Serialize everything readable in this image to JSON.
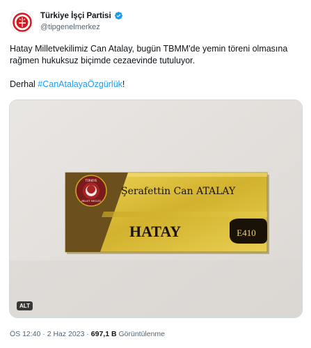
{
  "author": {
    "display_name": "Türkiye İşçi Partisi",
    "handle": "@tipgenelmerkez",
    "avatar_icon": "tip-logo-icon",
    "verified_icon": "verified-badge-icon",
    "verified_color": "#1d9bf0"
  },
  "tweet": {
    "text_line1": "Hatay Milletvekilimiz Can Atalay, bugün TBMM'de yemin töreni olmasına rağmen hukuksuz biçimde cezaevinde tutuluyor.",
    "text_prefix": "Derhal ",
    "hashtag": "#CanAtalayaÖzgürlük",
    "text_suffix": "!"
  },
  "media": {
    "plate_name": "Şerafettin Can ATALAY",
    "plate_city": "HATAY",
    "plate_room": "E410",
    "seal_text_top": "TÜRKİYE",
    "seal_text_bottom": "MİLLET MECLİSİ",
    "alt_label": "ALT"
  },
  "meta": {
    "time": "ÖS 12:40",
    "separator": "·",
    "date": "2 Haz 2023",
    "views_count": "697,1 B",
    "views_label": "Görüntülenme"
  },
  "colors": {
    "link": "#1d9bf0",
    "secondary_text": "#536471",
    "plate_gold": "#d8b93a",
    "seal_red": "#7a1a1a"
  }
}
